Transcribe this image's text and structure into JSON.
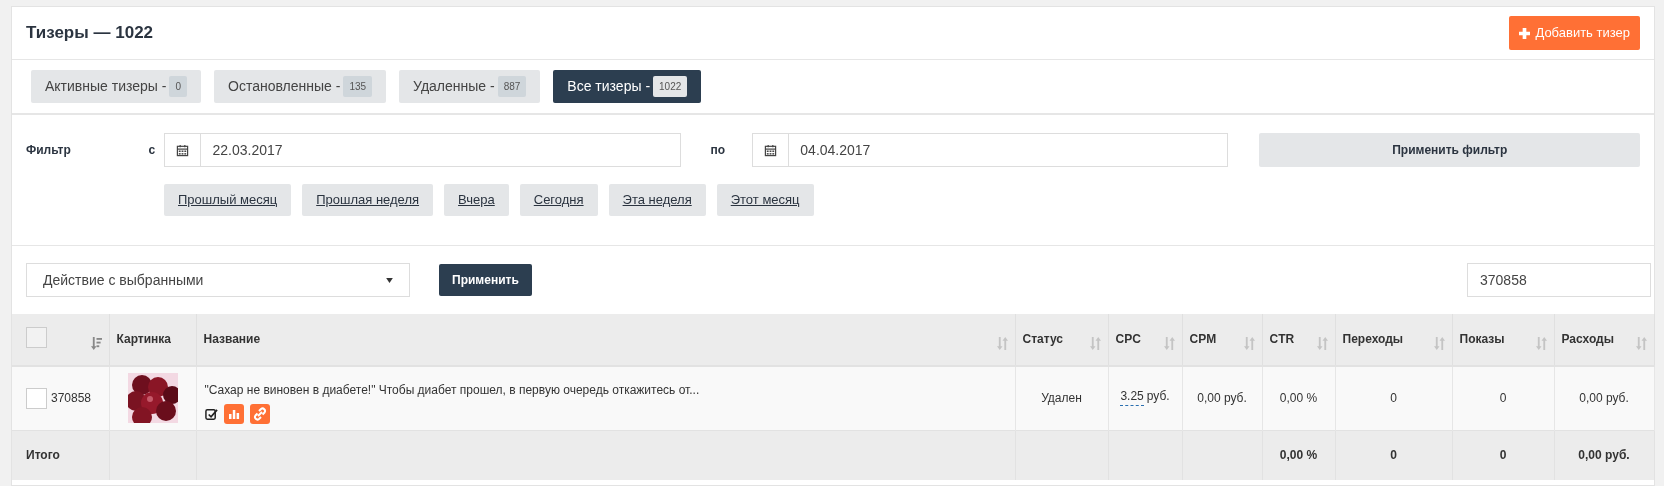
{
  "header": {
    "title": "Тизеры — 1022",
    "add_button": "Добавить тизер"
  },
  "tabs": [
    {
      "label": "Активные тизеры -",
      "count": "0",
      "selected": false
    },
    {
      "label": "Остановленные -",
      "count": "135",
      "selected": false
    },
    {
      "label": "Удаленные -",
      "count": "887",
      "selected": false
    },
    {
      "label": "Все тизеры -",
      "count": "1022",
      "selected": true
    }
  ],
  "filter": {
    "label": "Фильтр",
    "from_label": "с",
    "from_value": "22.03.2017",
    "to_label": "по",
    "to_value": "04.04.2017",
    "apply_button": "Применить фильтр",
    "quick_ranges": [
      "Прошлый месяц",
      "Прошлая неделя",
      "Вчера",
      "Сегодня",
      "Эта неделя",
      "Этот месяц"
    ]
  },
  "actions": {
    "select_value": "Действие с выбранными",
    "apply_button": "Применить",
    "search_value": "370858"
  },
  "table": {
    "columns": [
      {
        "kind": "checkbox",
        "checked": false,
        "sortable": true
      },
      {
        "kind": "text",
        "label": "Картинка",
        "sortable": false
      },
      {
        "kind": "text",
        "label": "Название",
        "sortable": true
      },
      {
        "kind": "text",
        "label": "Статус",
        "sortable": true
      },
      {
        "kind": "text",
        "label": "CPC",
        "sortable": true
      },
      {
        "kind": "text",
        "label": "CPM",
        "sortable": true
      },
      {
        "kind": "text",
        "label": "CTR",
        "sortable": true
      },
      {
        "kind": "text",
        "label": "Переходы",
        "sortable": true
      },
      {
        "kind": "text",
        "label": "Показы",
        "sortable": true
      },
      {
        "kind": "text",
        "label": "Расходы",
        "sortable": true
      }
    ],
    "rows": [
      {
        "checked": false,
        "id": "370858",
        "title": "\"Сахар не виновен в диабете!\" Чтобы диабет прошел, в первую очередь откажитесь от...",
        "status": "Удален",
        "cpc_value": "3.25",
        "cpc_unit": "руб.",
        "cpm": "0,00 руб.",
        "ctr": "0,00 %",
        "clicks": "0",
        "shows": "0",
        "spend": "0,00 руб."
      }
    ],
    "total": {
      "label": "Итого",
      "ctr": "0,00 %",
      "clicks": "0",
      "shows": "0",
      "spend": "0,00 руб."
    }
  }
}
